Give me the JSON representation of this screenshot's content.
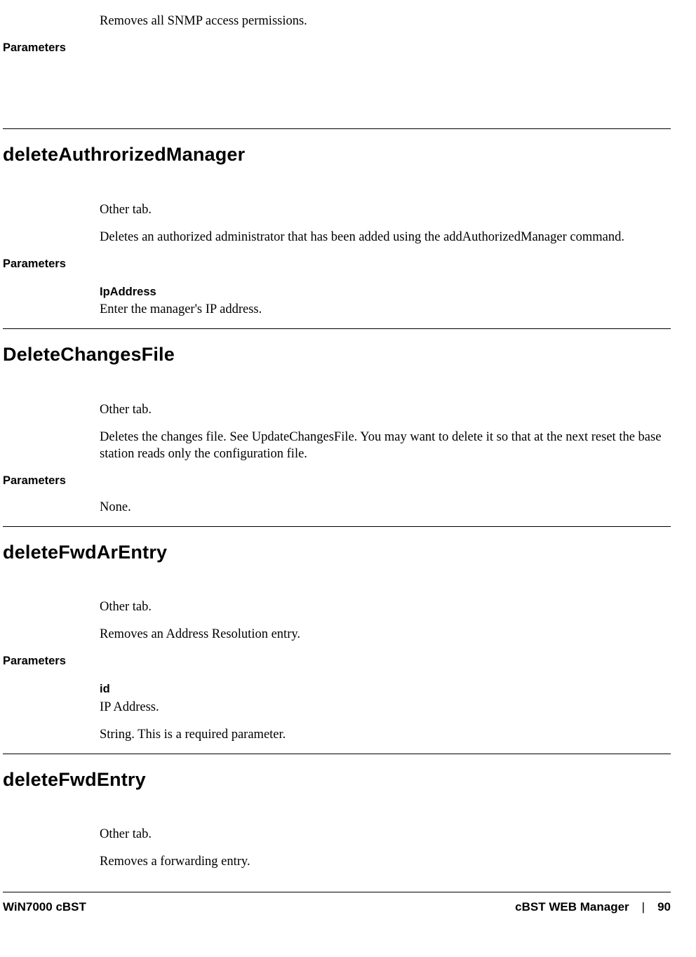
{
  "section0": {
    "intro_text": "Removes all SNMP access permissions.",
    "parameters_label": "Parameters"
  },
  "section1": {
    "heading": "deleteAuthrorizedManager",
    "tab_text": "Other tab.",
    "desc_text": "Deletes an authorized administrator that has been added using the addAuthorizedManager command.",
    "parameters_label": "Parameters",
    "param1_name": "IpAddress",
    "param1_desc": "Enter the manager's IP address."
  },
  "section2": {
    "heading": "DeleteChangesFile",
    "tab_text": "Other tab.",
    "desc_text": "Deletes the changes file. See UpdateChangesFile. You may want to delete it so that at the next reset the base station reads only the configuration file.",
    "parameters_label": "Parameters",
    "none_text": "None."
  },
  "section3": {
    "heading": "deleteFwdArEntry",
    "tab_text": "Other tab.",
    "desc_text": "Removes an Address Resolution entry.",
    "parameters_label": "Parameters",
    "param1_name": "id",
    "param1_desc": "IP Address.",
    "extra_text": "String. This is a required parameter."
  },
  "section4": {
    "heading": "deleteFwdEntry",
    "tab_text": "Other tab.",
    "desc_text": "Removes a forwarding entry."
  },
  "footer": {
    "left": "WiN7000 cBST",
    "right_label": "cBST WEB Manager",
    "separator": "|",
    "page_number": "90"
  }
}
